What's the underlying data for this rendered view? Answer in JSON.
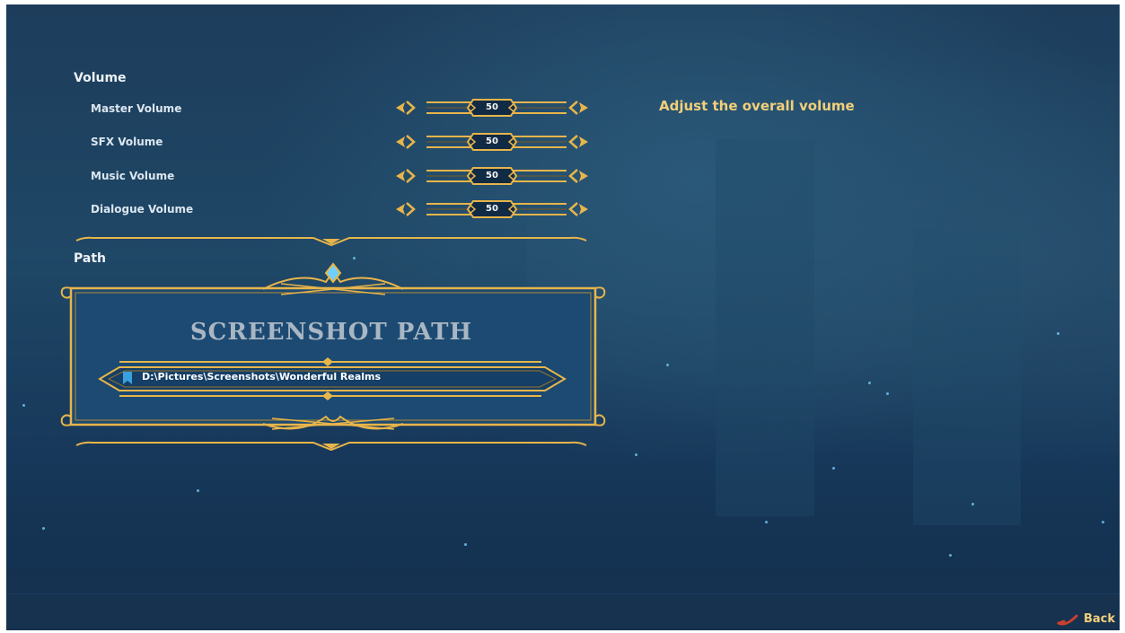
{
  "volume_section": {
    "title": "Volume",
    "rows": [
      {
        "label": "Master Volume",
        "value": "50"
      },
      {
        "label": "SFX Volume",
        "value": "50"
      },
      {
        "label": "Music Volume",
        "value": "50"
      },
      {
        "label": "Dialogue Volume",
        "value": "50"
      }
    ]
  },
  "description": "Adjust the overall volume",
  "path_section": {
    "title": "Path",
    "panel_title": "SCREENSHOT PATH",
    "path_value": "D:\\Pictures\\Screenshots\\Wonderful Realms"
  },
  "footer": {
    "back_label": "Back"
  },
  "colors": {
    "gold": "#e8b54a",
    "accent_text": "#f2cf7a",
    "panel_bg": "#1c4a72"
  }
}
